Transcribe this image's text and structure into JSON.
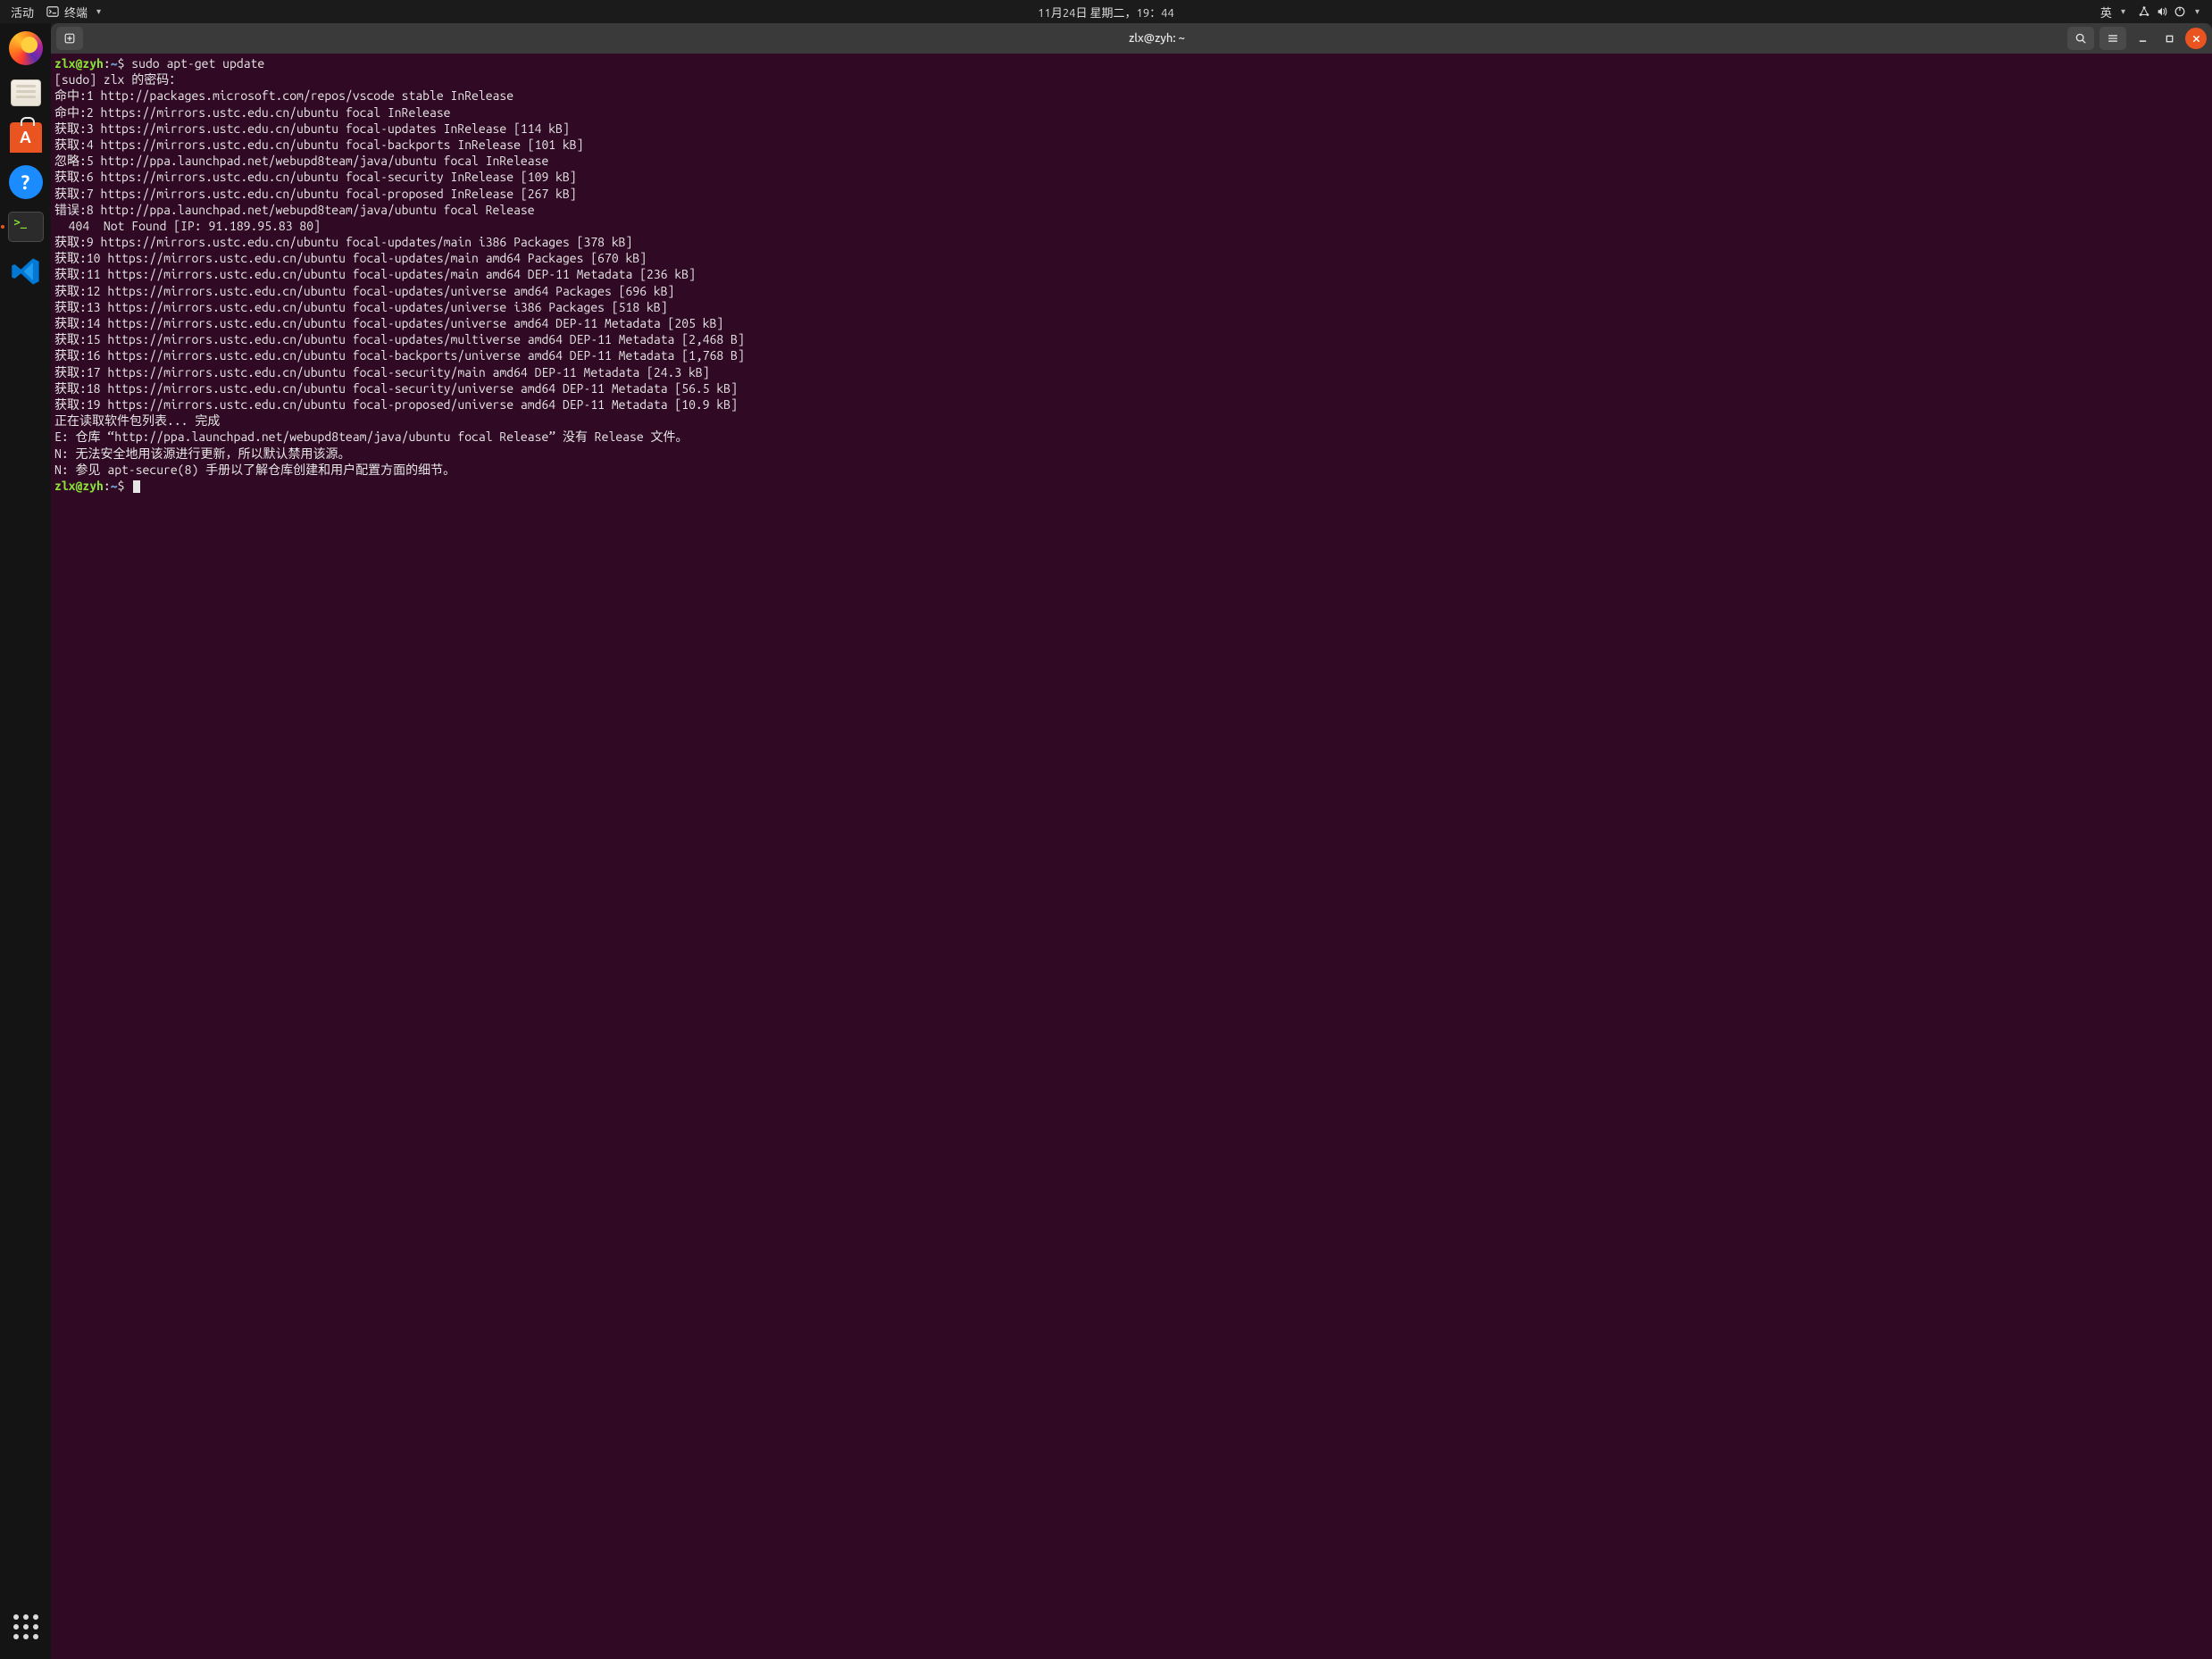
{
  "topbar": {
    "activities": "活动",
    "appmenu": "终端",
    "clock": "11月24日 星期二，19：44",
    "input_method": "英"
  },
  "dock": {
    "items": [
      {
        "name": "firefox",
        "label": "Firefox"
      },
      {
        "name": "files",
        "label": "Files"
      },
      {
        "name": "ubuntu-software",
        "label": "Ubuntu Software"
      },
      {
        "name": "help",
        "label": "Help"
      },
      {
        "name": "terminal",
        "label": "Terminal",
        "active": true
      },
      {
        "name": "vscode",
        "label": "Visual Studio Code"
      }
    ]
  },
  "window": {
    "title": "zlx@zyh: ~"
  },
  "prompt": {
    "user_host": "zlx@zyh",
    "path": "~",
    "symbol": "$"
  },
  "terminal": {
    "command": "sudo apt-get update",
    "lines": [
      "[sudo] zlx 的密码：",
      "命中:1 http://packages.microsoft.com/repos/vscode stable InRelease",
      "命中:2 https://mirrors.ustc.edu.cn/ubuntu focal InRelease",
      "获取:3 https://mirrors.ustc.edu.cn/ubuntu focal-updates InRelease [114 kB]",
      "获取:4 https://mirrors.ustc.edu.cn/ubuntu focal-backports InRelease [101 kB]",
      "忽略:5 http://ppa.launchpad.net/webupd8team/java/ubuntu focal InRelease",
      "获取:6 https://mirrors.ustc.edu.cn/ubuntu focal-security InRelease [109 kB]",
      "获取:7 https://mirrors.ustc.edu.cn/ubuntu focal-proposed InRelease [267 kB]",
      "错误:8 http://ppa.launchpad.net/webupd8team/java/ubuntu focal Release",
      "  404  Not Found [IP: 91.189.95.83 80]",
      "获取:9 https://mirrors.ustc.edu.cn/ubuntu focal-updates/main i386 Packages [378 kB]",
      "获取:10 https://mirrors.ustc.edu.cn/ubuntu focal-updates/main amd64 Packages [670 kB]",
      "获取:11 https://mirrors.ustc.edu.cn/ubuntu focal-updates/main amd64 DEP-11 Metadata [236 kB]",
      "获取:12 https://mirrors.ustc.edu.cn/ubuntu focal-updates/universe amd64 Packages [696 kB]",
      "获取:13 https://mirrors.ustc.edu.cn/ubuntu focal-updates/universe i386 Packages [518 kB]",
      "获取:14 https://mirrors.ustc.edu.cn/ubuntu focal-updates/universe amd64 DEP-11 Metadata [205 kB]",
      "获取:15 https://mirrors.ustc.edu.cn/ubuntu focal-updates/multiverse amd64 DEP-11 Metadata [2,468 B]",
      "获取:16 https://mirrors.ustc.edu.cn/ubuntu focal-backports/universe amd64 DEP-11 Metadata [1,768 B]",
      "获取:17 https://mirrors.ustc.edu.cn/ubuntu focal-security/main amd64 DEP-11 Metadata [24.3 kB]",
      "获取:18 https://mirrors.ustc.edu.cn/ubuntu focal-security/universe amd64 DEP-11 Metadata [56.5 kB]",
      "获取:19 https://mirrors.ustc.edu.cn/ubuntu focal-proposed/universe amd64 DEP-11 Metadata [10.9 kB]",
      "正在读取软件包列表... 完成",
      "E: 仓库 “http://ppa.launchpad.net/webupd8team/java/ubuntu focal Release” 没有 Release 文件。",
      "N: 无法安全地用该源进行更新，所以默认禁用该源。",
      "N: 参见 apt-secure(8) 手册以了解仓库创建和用户配置方面的细节。"
    ]
  }
}
